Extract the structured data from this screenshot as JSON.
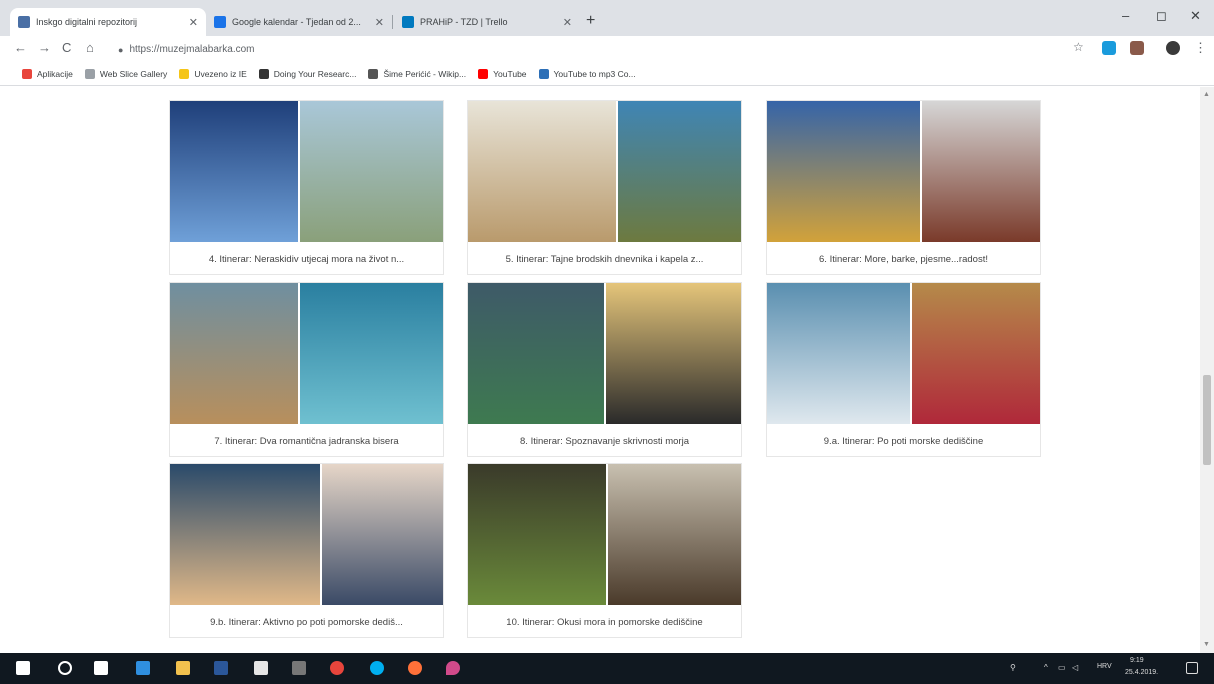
{
  "tabs": [
    {
      "title": "Inskgo digitalni repozitorij",
      "favicon_color": "#4a6fa5"
    },
    {
      "title": "Google kalendar - Tjedan od 2...",
      "favicon_color": "#1a73e8"
    },
    {
      "title": "PRAHiP - TZD | Trello",
      "favicon_color": "#0079bf"
    }
  ],
  "window_controls": {
    "minimize": "–",
    "maximize": "◻",
    "close": "✕"
  },
  "toolbar": {
    "back": "←",
    "forward": "→",
    "reload": "C",
    "home": "⌂",
    "url": "https://muzejmalabarka.com",
    "lock": "🔒"
  },
  "bookmarks": [
    {
      "label": "Aplikacije",
      "color": "#e8453c"
    },
    {
      "label": "Web Slice Gallery",
      "color": "#9aa0a6"
    },
    {
      "label": "Uvezeno iz IE",
      "color": "#f5c518"
    },
    {
      "label": "Doing Your Researc...",
      "color": "#333333"
    },
    {
      "label": "Šime Perićić - Wikip...",
      "color": "#555555"
    },
    {
      "label": "YouTube",
      "color": "#ff0000"
    },
    {
      "label": "YouTube to mp3 Co...",
      "color": "#2c6fb7"
    }
  ],
  "cards": [
    {
      "caption": "4. Itinerar: Neraskidiv utjecaj mora na život n...",
      "left": [
        "#1f3f7a",
        "#6fa0d8"
      ],
      "right": [
        "#a9c7d8",
        "#8aa07a"
      ]
    },
    {
      "caption": "5. Itinerar: Tajne brodskih dnevnika i kapela z...",
      "left": [
        "#e8e4d8",
        "#b99a6c"
      ],
      "right": [
        "#3f85b5",
        "#6d7a3f"
      ]
    },
    {
      "caption": "6. Itinerar: More, barke, pjesme...radost!",
      "left": [
        "#3564a8",
        "#d2a23a"
      ],
      "right": [
        "#d6d6d6",
        "#7a3a2a"
      ]
    },
    {
      "caption": "7. Itinerar: Dva romantična jadranska bisera",
      "left": [
        "#6f8fa0",
        "#b88f5c"
      ],
      "right": [
        "#2a7fa0",
        "#6fc0d0"
      ]
    },
    {
      "caption": "8. Itinerar: Spoznavanje skrivnosti morja",
      "left": [
        "#3e5a68",
        "#3e7a50"
      ],
      "right": [
        "#e5c57a",
        "#2a2a2a"
      ]
    },
    {
      "caption": "9.a. Itinerar: Po poti morske dediščine",
      "left": [
        "#5a8fb0",
        "#dfe8ee"
      ],
      "right": [
        "#b58a4a",
        "#b0283a"
      ]
    },
    {
      "caption": "9.b. Itinerar: Aktivno po poti pomorske dediš...",
      "left": [
        "#2a4a6a",
        "#e0b888"
      ],
      "right": [
        "#e6d6c8",
        "#3a4a66"
      ]
    },
    {
      "caption": "10. Itinerar: Okusi mora in pomorske dediščine",
      "left": [
        "#3a3a2a",
        "#6a8a3a"
      ],
      "right": [
        "#c8c0b0",
        "#4a3a2a"
      ]
    }
  ],
  "taskbar": {
    "apps": [
      {
        "name": "windows-start",
        "color": "#ffffff"
      },
      {
        "name": "search",
        "color": "#ffffff"
      },
      {
        "name": "task-view",
        "color": "#ffffff"
      },
      {
        "name": "edge",
        "color": "#2f8fe0"
      },
      {
        "name": "file-explorer",
        "color": "#f2c14e"
      },
      {
        "name": "word",
        "color": "#2b579a"
      },
      {
        "name": "store",
        "color": "#e6e6e6"
      },
      {
        "name": "media",
        "color": "#777777"
      },
      {
        "name": "chrome",
        "color": "#e8453c"
      },
      {
        "name": "skype",
        "color": "#00aff0"
      },
      {
        "name": "firefox",
        "color": "#ff7139"
      },
      {
        "name": "maps",
        "color": "#d14a8a"
      }
    ],
    "tray_lang": "HRV",
    "time": "9:19",
    "date": "25.4.2019."
  }
}
